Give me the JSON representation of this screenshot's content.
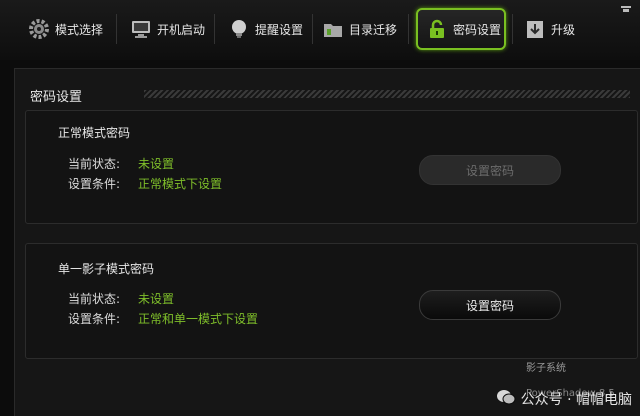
{
  "toolbar": {
    "tabs": [
      {
        "label": "模式选择",
        "icon": "gear-icon"
      },
      {
        "label": "开机启动",
        "icon": "monitor-icon"
      },
      {
        "label": "提醒设置",
        "icon": "bulb-icon"
      },
      {
        "label": "目录迁移",
        "icon": "folder-icon"
      },
      {
        "label": "密码设置",
        "icon": "lock-icon"
      },
      {
        "label": "升级",
        "icon": "upgrade-icon"
      }
    ],
    "active_tab": "密码设置"
  },
  "main": {
    "section_title": "密码设置",
    "normal_mode": {
      "title": "正常模式密码",
      "status_label": "当前状态:",
      "status_value": "未设置",
      "condition_label": "设置条件:",
      "condition_value": "正常模式下设置",
      "button_label": "设置密码",
      "button_enabled": false
    },
    "shadow_mode": {
      "title": "单一影子模式密码",
      "status_label": "当前状态:",
      "status_value": "未设置",
      "condition_label": "设置条件:",
      "condition_value": "正常和单一模式下设置",
      "button_label": "设置密码",
      "button_enabled": true
    }
  },
  "watermark": {
    "brand_line": "影子系统",
    "text": "公众号 · 帽帽电脑",
    "version_line": "PowerShadow 8.5"
  },
  "colors": {
    "accent": "#7ac021",
    "status_green": "#7fbf2a"
  }
}
